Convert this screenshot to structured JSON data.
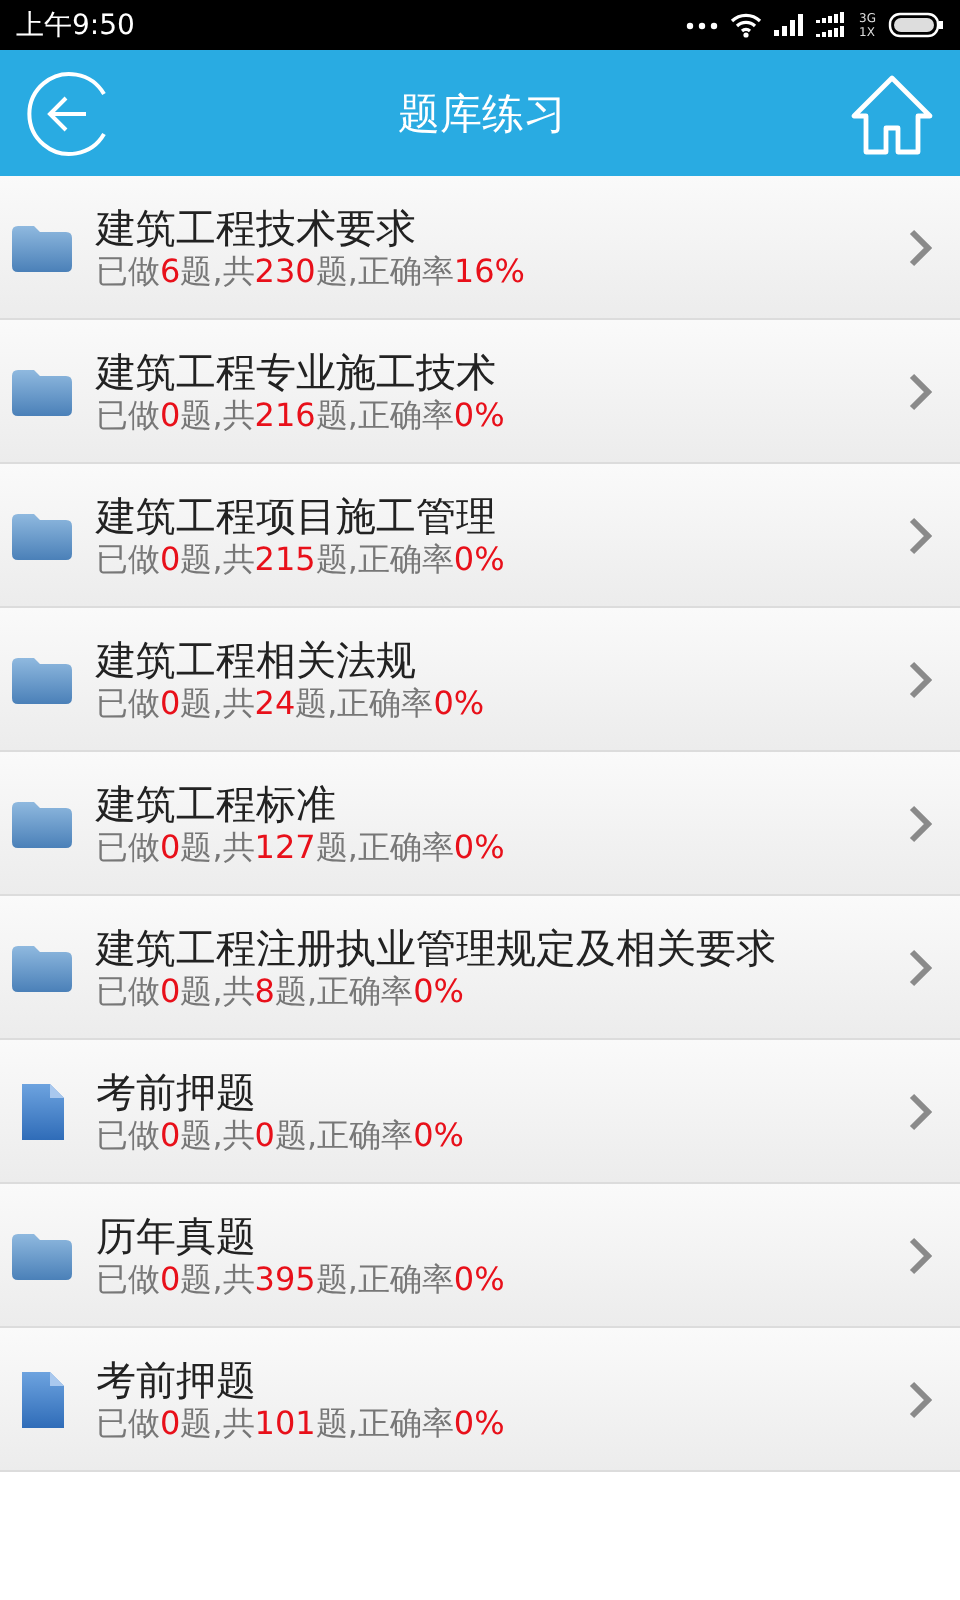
{
  "status_bar": {
    "time": "上午9:50",
    "network_top": "3G",
    "network_bottom": "1X"
  },
  "header": {
    "title": "题库练习"
  },
  "items": [
    {
      "kind": "folder",
      "title": "建筑工程技术要求",
      "stats": [
        "已做",
        "6",
        "题,共",
        "230",
        "题,正确率",
        "16%"
      ]
    },
    {
      "kind": "folder",
      "title": "建筑工程专业施工技术",
      "stats": [
        "已做",
        "0",
        "题,共",
        "216",
        "题,正确率",
        "0%"
      ]
    },
    {
      "kind": "folder",
      "title": "建筑工程项目施工管理",
      "stats": [
        "已做",
        "0",
        "题,共",
        "215",
        "题,正确率",
        "0%"
      ]
    },
    {
      "kind": "folder",
      "title": "建筑工程相关法规",
      "stats": [
        "已做",
        "0",
        "题,共",
        "24",
        "题,正确率",
        "0%"
      ]
    },
    {
      "kind": "folder",
      "title": "建筑工程标准",
      "stats": [
        "已做",
        "0",
        "题,共",
        "127",
        "题,正确率",
        "0%"
      ]
    },
    {
      "kind": "folder",
      "title": "建筑工程注册执业管理规定及相关要求",
      "stats": [
        "已做",
        "0",
        "题,共",
        "8",
        "题,正确率",
        "0%"
      ]
    },
    {
      "kind": "document",
      "title": "考前押题",
      "stats": [
        "已做",
        "0",
        "题,共",
        "0",
        "题,正确率",
        "0%"
      ]
    },
    {
      "kind": "folder",
      "title": "历年真题",
      "stats": [
        "已做",
        "0",
        "题,共",
        "395",
        "题,正确率",
        "0%"
      ]
    },
    {
      "kind": "document",
      "title": "考前押题",
      "stats": [
        "已做",
        "0",
        "题,共",
        "101",
        "题,正确率",
        "0%"
      ]
    }
  ]
}
